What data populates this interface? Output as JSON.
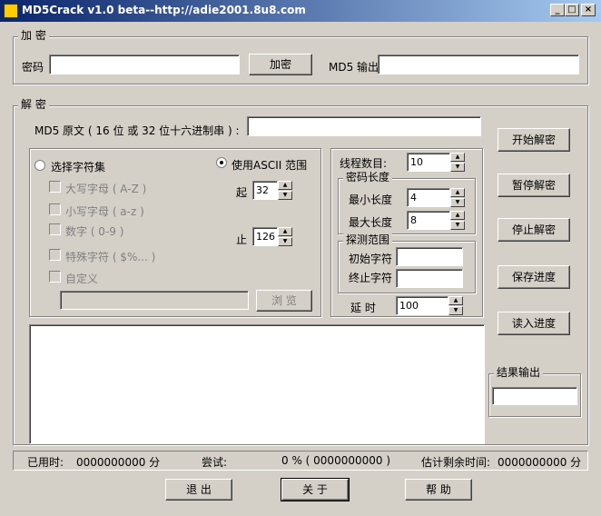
{
  "window": {
    "title": "MD5Crack v1.0 beta--http://adie2001.8u8.com",
    "min": "_",
    "max": "□",
    "close": "×"
  },
  "encrypt": {
    "legend": "加 密",
    "password_label": "密码",
    "password_value": "",
    "encrypt_button": "加密",
    "md5_output_label": "MD5 输出",
    "md5_output_value": ""
  },
  "decrypt": {
    "legend": "解 密",
    "md5_source_label": "MD5 原文 ( 16 位 或 32 位十六进制串 ) :",
    "md5_source_value": "",
    "charset": {
      "select_charset_label": "选择字符集",
      "use_ascii_label": "使用ASCII 范围",
      "uppercase_label": "大写字母 ( A-Z )",
      "lowercase_label": "小写字母 ( a-z )",
      "digits_label": "数字 ( 0-9 )",
      "special_label": "特殊字符 ( $%... )",
      "custom_label": "自定义",
      "custom_value": "",
      "browse_button": "浏 览",
      "from_label": "起",
      "from_value": "32",
      "to_label": "止",
      "to_value": "126"
    },
    "threads_label": "线程数目:",
    "threads_value": "10",
    "pwlen_legend": "密码长度",
    "min_len_label": "最小长度",
    "min_len_value": "4",
    "max_len_label": "最大长度",
    "max_len_value": "8",
    "probe_legend": "探测范围",
    "start_char_label": "初始字符",
    "start_char_value": "",
    "end_char_label": "终止字符",
    "end_char_value": "",
    "delay_label": "延  时",
    "delay_value": "100"
  },
  "actions": {
    "start": "开始解密",
    "pause": "暂停解密",
    "stop": "停止解密",
    "save": "保存进度",
    "load": "读入进度"
  },
  "result": {
    "legend": "结果输出",
    "value": ""
  },
  "status": {
    "elapsed_label": "已用时:",
    "elapsed_value": "0000000000  分",
    "tried_label": "尝试:",
    "tried_value": "0 % (     0000000000 )",
    "remaining_label": "估计剩余时间:",
    "remaining_value": "0000000000  分"
  },
  "bottom": {
    "exit": "退 出",
    "about": "关 于",
    "help": "帮 助"
  }
}
